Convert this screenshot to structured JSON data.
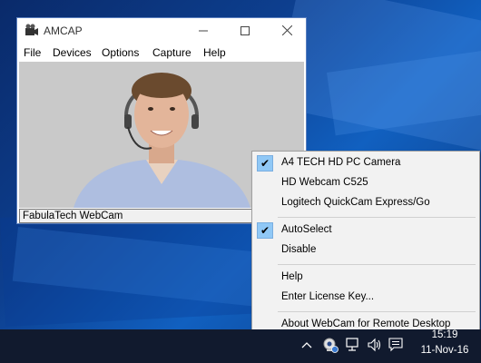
{
  "window": {
    "title": "AMCAP",
    "menus": [
      "File",
      "Devices",
      "Options",
      "Capture",
      "Help"
    ],
    "status": "FabulaTech WebCam"
  },
  "context_menu": {
    "items": [
      {
        "label": "A4 TECH HD PC Camera",
        "checked": true
      },
      {
        "label": "HD Webcam C525",
        "checked": false
      },
      {
        "label": "Logitech QuickCam Express/Go",
        "checked": false
      },
      {
        "label": "AutoSelect",
        "checked": true
      },
      {
        "label": "Disable",
        "checked": false
      },
      {
        "label": "Help",
        "checked": false
      },
      {
        "label": "Enter License Key...",
        "checked": false
      },
      {
        "label": "About WebCam for Remote Desktop",
        "checked": false
      }
    ],
    "check_glyph": "✔"
  },
  "taskbar": {
    "time": "15:19",
    "date": "11-Nov-16",
    "tray_icons": [
      "chevron-up-icon",
      "webcam-tray-icon",
      "network-icon",
      "volume-icon",
      "notification-icon"
    ]
  },
  "colors": {
    "menu_check_bg": "#90c8f6",
    "taskbar_bg": "#111a2e",
    "desktop_blue": "#0d3f8f"
  }
}
